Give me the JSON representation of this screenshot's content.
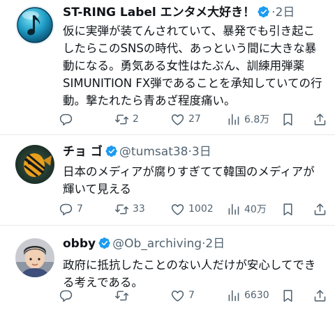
{
  "tweets": [
    {
      "name": "ST-RING Label エンタメ大好き！",
      "handle": "",
      "dot": "·",
      "time": "2日",
      "verified": true,
      "text": "仮に実弾が装てんされていて、暴発でも引き起こしたらこのSNSの時代、あっという間に大きな暴動になる。勇気ある女性はたぶん、訓練用弾薬 SIMUNITION FX弾であることを承知していての行動。撃たれたら青あざ程度痛い。",
      "replies": "",
      "retweets": "2",
      "likes": "27",
      "views": "6.8万",
      "avatar_icon": "music-note-icon"
    },
    {
      "name": "チョ ゴ",
      "handle": "@tumsat38",
      "dot": "·",
      "time": "3日",
      "verified": true,
      "text": "日本のメディアが腐りすぎてて韓国のメディアが輝いて見える",
      "replies": "7",
      "retweets": "33",
      "likes": "1002",
      "views": "40万",
      "avatar_icon": "fish-photo"
    },
    {
      "name": "obby",
      "handle": "@Ob_archiving",
      "dot": "·",
      "time": "2日",
      "verified": true,
      "text": "政府に抵抗したことのない人だけが安心してできる考えである。",
      "replies": "",
      "retweets": "",
      "likes": "7",
      "views": "6630",
      "avatar_icon": "child-photo"
    }
  ],
  "colors": {
    "text": "#0f1419",
    "muted": "#536471",
    "verified": "#1d9bf0",
    "divider": "#e7e9ea"
  }
}
